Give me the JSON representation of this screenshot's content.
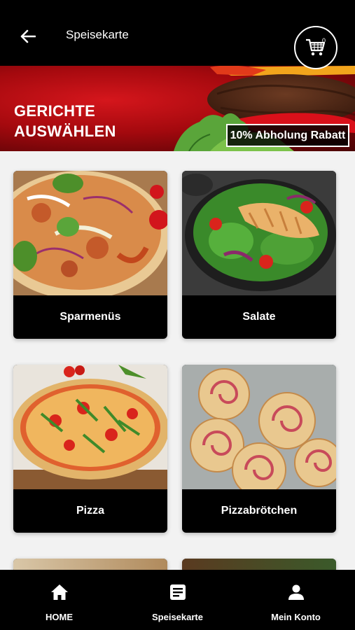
{
  "header": {
    "title": "Speisekarte",
    "back_icon": "arrow-left-icon",
    "cart_icon": "shopping-cart-icon",
    "cart_count": "0"
  },
  "banner": {
    "title_line1": "GERICHTE",
    "title_line2": "AUSWÄHLEN",
    "badge": "10% Abholung Rabatt"
  },
  "categories": [
    {
      "label": "Sparmenüs"
    },
    {
      "label": "Salate"
    },
    {
      "label": "Pizza"
    },
    {
      "label": "Pizzabrötchen"
    }
  ],
  "bottom_nav": {
    "items": [
      {
        "label": "HOME",
        "icon": "home-icon"
      },
      {
        "label": "Speisekarte",
        "icon": "menu-list-icon"
      },
      {
        "label": "Mein Konto",
        "icon": "user-icon"
      }
    ]
  },
  "colors": {
    "bar": "#000000",
    "banner_red": "#c0121a",
    "background": "#f2f2f2"
  }
}
